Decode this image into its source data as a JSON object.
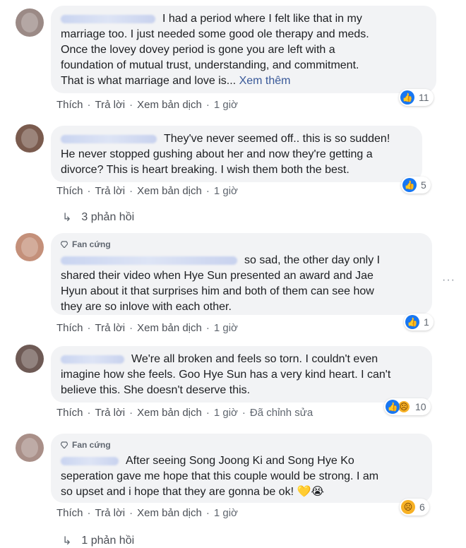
{
  "actions": {
    "like": "Thích",
    "reply": "Trả lời",
    "translate": "Xem bản dịch",
    "time": "1 giờ",
    "edited": "Đã chỉnh sửa"
  },
  "comments": [
    {
      "text": "I had a period where I felt like that in my\nmarriage too. I just needed some good ole therapy and meds.\nOnce the lovey dovey period is gone you are left with a\nfoundation of mutual trust, understanding, and commitment.\nThat is what marriage and love is...",
      "see_more": "Xem thêm",
      "reaction_count": "11"
    },
    {
      "text": "They've never seemed off.. this is so sudden!\nHe never stopped gushing about her and now they're getting a\ndivorce? This is heart breaking. I wish them both the best.",
      "reaction_count": "5",
      "replies_label": "3 phản hồi"
    },
    {
      "badge": "Fan cứng",
      "text": "so sad, the other day only I\nshared their video when Hye Sun presented an award and Jae\nHyun about it that surprises him and both of them can see how\nthey are so inlove with each other.",
      "reaction_count": "1"
    },
    {
      "text": "We're all broken and feels so torn. I couldn't even\nimagine how she feels. Goo Hye Sun has a very kind heart. I can't\nbelieve this. She doesn't deserve this.",
      "reaction_count": "10"
    },
    {
      "badge": "Fan cứng",
      "text": "After seeing Song Joong Ki and Song Hye Ko\nseperation gave me hope that this couple would be strong. I am\nso upset and i hope that they are gonna be ok!",
      "reaction_count": "6",
      "replies_label": "1 phản hồi"
    }
  ],
  "colors": {
    "like_blue": "#1877f2",
    "bubble_bg": "#f2f3f5",
    "link": "#385898"
  }
}
